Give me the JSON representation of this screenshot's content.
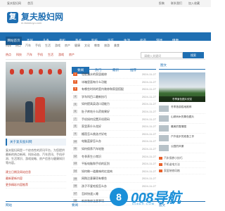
{
  "topbar": {
    "left": [
      "复夫股妇网",
      "首页"
    ],
    "right": [
      "投稿",
      "联系我们",
      "加入收藏"
    ]
  },
  "header": {
    "logo_char": "复",
    "title": "复夫股妇网",
    "subtitle": "m.fanshuyu.com"
  },
  "nav": {
    "items": [
      "网站首页",
      "高尿",
      "头条",
      "手机",
      "热点",
      "科技",
      "汽车",
      "生活",
      "房产",
      "游戏",
      "健康"
    ]
  },
  "subnav": {
    "items": [
      "科技",
      "热点",
      "汽车",
      "手机",
      "生活",
      "游戏",
      "房产",
      "健康",
      "文化",
      "教育",
      "旅游",
      "美食"
    ]
  },
  "tags": {
    "items": [
      "热点",
      "科技",
      "汽车",
      "手机",
      "生活",
      "游戏",
      "房产"
    ]
  },
  "search": {
    "placeholder": "请输入关键词",
    "button": "搜索"
  },
  "left": {
    "card_title": "关于复夫股妇网",
    "description": "复夫股妇网是一个综合性的资讯平台，为您提供最新的热点新闻、科技动态、汽车资讯、手机评测、生活常识、游戏攻略、房产信息与健康知识等内容。",
    "links": [
      "建立日期及网站信息",
      "最新更新内容",
      "更多精彩内容推荐"
    ]
  },
  "middle": {
    "tabs": [
      "要闻",
      "热门",
      "最新",
      "推荐",
      "排行"
    ],
    "news": [
      {
        "n": "1",
        "title": "墙壁漏水的家居维修",
        "date": "2024-11-27"
      },
      {
        "n": "2",
        "title": "冰箱里面有什么功能",
        "date": "2024-11-27"
      },
      {
        "n": "3",
        "title": "有哪些时尚的室内装修和家居搭配",
        "date": "2024-11-27"
      },
      {
        "n": "4",
        "title": "学车科目二最新技巧",
        "date": "2024-11-27"
      },
      {
        "n": "5",
        "title": "如何提高英语口语能力",
        "date": "2024-11-27"
      },
      {
        "n": "6",
        "title": "肚子疼吃什么药效果好",
        "date": "2024-11-27"
      },
      {
        "n": "7",
        "title": "手机如何设置开机密码",
        "date": "2024-11-27"
      },
      {
        "n": "8",
        "title": "家里养什么花好",
        "date": "2024-11-27"
      },
      {
        "n": "9",
        "title": "榴莲怎么挑选才好吃",
        "date": "2024-11-27"
      },
      {
        "n": "10",
        "title": "电脑蓝屏怎么办",
        "date": "2024-11-27"
      },
      {
        "n": "11",
        "title": "如何保养汽车轮胎",
        "date": "2024-11-27"
      },
      {
        "n": "12",
        "title": "冬季养生小常识",
        "date": "2024-11-27"
      },
      {
        "n": "13",
        "title": "平板电脑和手机的区别",
        "date": "2024-11-27"
      },
      {
        "n": "14",
        "title": "如何做一道美味的红烧肉",
        "date": "2024-11-27"
      },
      {
        "n": "15",
        "title": "网购注意事项有哪些",
        "date": "2024-11-27"
      },
      {
        "n": "16",
        "title": "孩子不爱吃饭怎么办",
        "date": "2024-11-27"
      },
      {
        "n": "17",
        "title": "怎样快速入睡",
        "date": "2024-11-27"
      },
      {
        "n": "18",
        "title": "新房装修注意事项",
        "date": "2024-11-27"
      }
    ]
  },
  "right": {
    "title": "图文",
    "photo_caption": "冬季景色图片欣赏",
    "items": [
      "冬季旅游胜地推荐",
      "山坡树木的景色图片",
      "最美的雪景图",
      "户外徒步的准备工作",
      "公园的风景"
    ],
    "small": [
      "汽车保养小技巧",
      "手机省电方法",
      "家居装修风格"
    ]
  },
  "bottom": {
    "left": "网站",
    "mid": "要闻",
    "right": "图文"
  },
  "watermark": {
    "icon": "8",
    "text": "008导航",
    "sub": "008DH.COM"
  }
}
